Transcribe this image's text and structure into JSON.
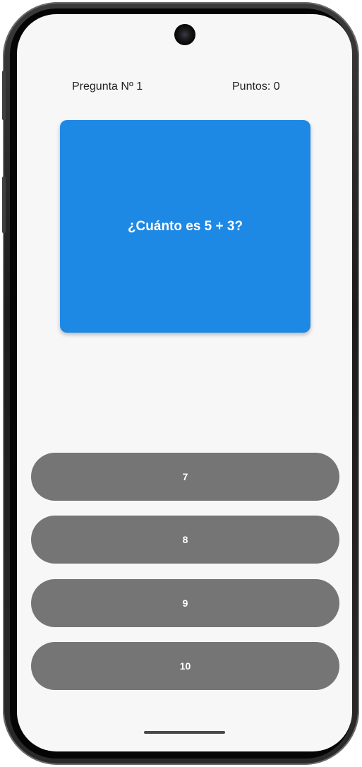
{
  "header": {
    "question_number": "Pregunta Nº 1",
    "score": "Puntos: 0"
  },
  "question": {
    "text": "¿Cuánto es 5 + 3?"
  },
  "answers": [
    {
      "label": "7"
    },
    {
      "label": "8"
    },
    {
      "label": "9"
    },
    {
      "label": "10"
    }
  ],
  "colors": {
    "card": "#1e88e5",
    "answer_button": "#757575",
    "background": "#f7f7f7"
  }
}
